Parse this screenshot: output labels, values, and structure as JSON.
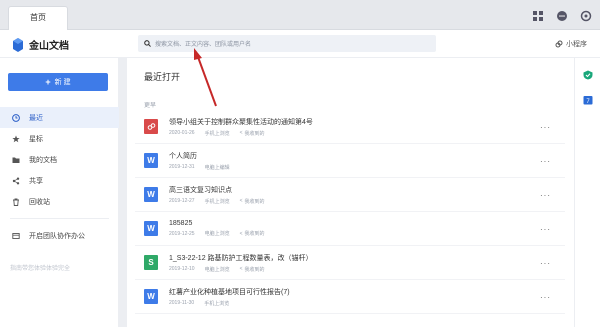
{
  "titlebar": {
    "tab_home": "首页"
  },
  "app": {
    "logo_text": "金山文档",
    "search_placeholder": "搜索文档、正文内容、团队或用户名",
    "mini_program": "小程序"
  },
  "sidebar": {
    "new_button": "新 建",
    "items": [
      {
        "label": "最近",
        "icon": "clock-icon",
        "active": true
      },
      {
        "label": "星标",
        "icon": "star-icon",
        "active": false
      },
      {
        "label": "我的文档",
        "icon": "folder-icon",
        "active": false
      },
      {
        "label": "共享",
        "icon": "share-icon",
        "active": false
      },
      {
        "label": "回收站",
        "icon": "trash-icon",
        "active": false
      }
    ],
    "team_item": "开启团队协作办公",
    "footer": "指南带您体验体验完全"
  },
  "main": {
    "section_title": "最近打开",
    "group_label": "更早",
    "files": [
      {
        "name": "领导小组关于控制群众聚集性活动的通知第4号",
        "date": "2020-01-26",
        "device": "手机上浏览",
        "received": "我收到的",
        "type": "pdf",
        "color": "#d94a4a"
      },
      {
        "name": "个人简历",
        "date": "2019-12-31",
        "device": "电脑上编辑",
        "received": "",
        "type": "word",
        "color": "#3e7be8"
      },
      {
        "name": "高三语文复习知识点",
        "date": "2019-12-27",
        "device": "手机上浏览",
        "received": "我收到的",
        "type": "word",
        "color": "#3e7be8"
      },
      {
        "name": "185825",
        "date": "2019-12-25",
        "device": "电脑上浏览",
        "received": "我收到的",
        "type": "word",
        "color": "#3e7be8"
      },
      {
        "name": "1_S3-22-12 路基防护工程数量表，改（锚杆）",
        "date": "2019-12-10",
        "device": "电脑上浏览",
        "received": "我收到的",
        "type": "sheet",
        "color": "#2fa968"
      },
      {
        "name": "红薯产业化种植基地项目可行性报告(7)",
        "date": "2019-11-30",
        "device": "手机上浏览",
        "received": "",
        "type": "word",
        "color": "#3e7be8"
      }
    ]
  },
  "icons": {
    "word_glyph": "W",
    "sheet_glyph": "S"
  },
  "colors": {
    "accent": "#3e7be8",
    "pdf": "#d94a4a",
    "sheet": "#2fa968"
  }
}
